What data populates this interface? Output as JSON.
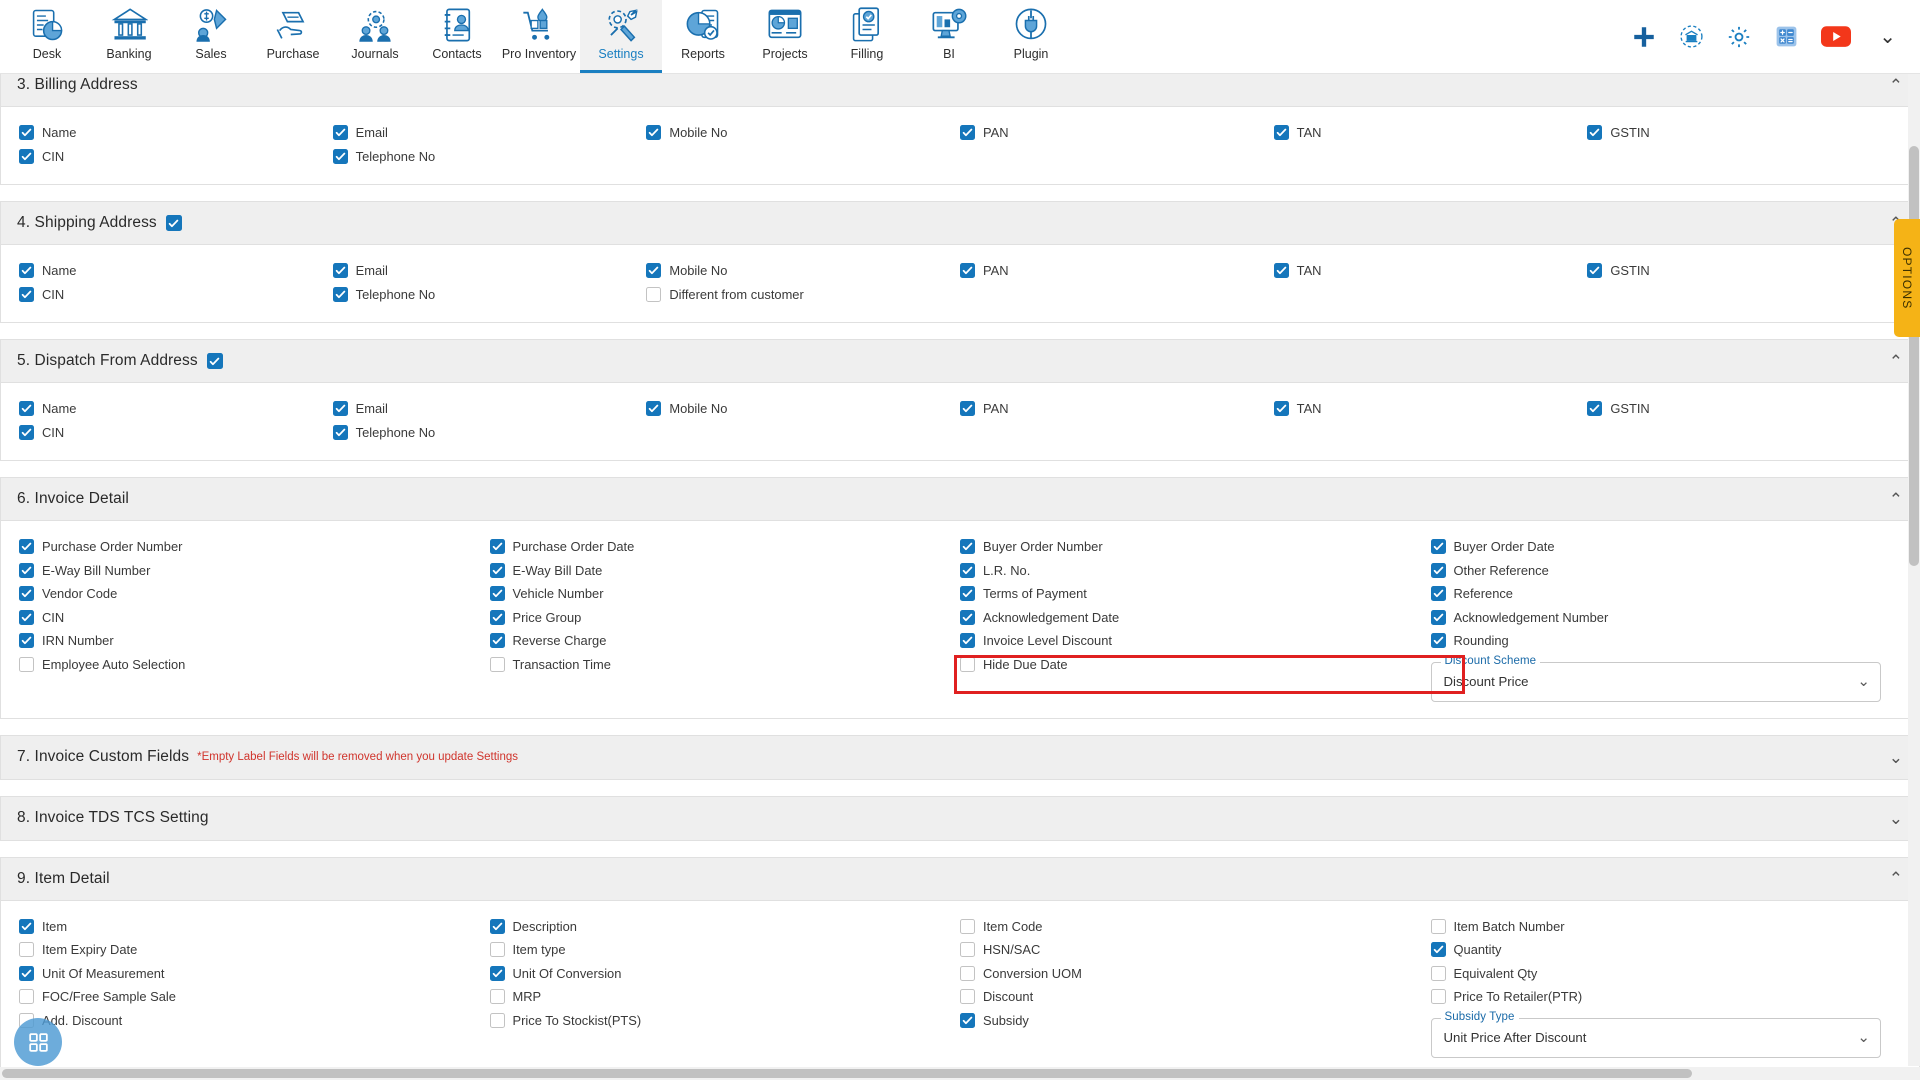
{
  "topnav": {
    "items": [
      {
        "label": "Desk",
        "icon": "desk-chart-icon",
        "active": false
      },
      {
        "label": "Banking",
        "icon": "bank-icon",
        "active": false
      },
      {
        "label": "Sales",
        "icon": "sales-tag-icon",
        "active": false
      },
      {
        "label": "Purchase",
        "icon": "purchase-bag-icon",
        "active": false
      },
      {
        "label": "Journals",
        "icon": "journals-gear-people-icon",
        "active": false
      },
      {
        "label": "Contacts",
        "icon": "contacts-book-icon",
        "active": false
      },
      {
        "label": "Pro Inventory",
        "icon": "inventory-cart-icon",
        "active": false
      },
      {
        "label": "Settings",
        "icon": "settings-tools-icon",
        "active": true
      },
      {
        "label": "Reports",
        "icon": "reports-pie-icon",
        "active": false
      },
      {
        "label": "Projects",
        "icon": "projects-board-icon",
        "active": false
      },
      {
        "label": "Filling",
        "icon": "filling-doc-check-icon",
        "active": false
      },
      {
        "label": "BI",
        "icon": "bi-monitor-icon",
        "active": false
      },
      {
        "label": "Plugin",
        "icon": "plugin-plug-icon",
        "active": false
      }
    ],
    "tools": [
      {
        "name": "add-plus-icon"
      },
      {
        "name": "bank-sync-icon"
      },
      {
        "name": "gear-icon"
      },
      {
        "name": "calculator-icon"
      },
      {
        "name": "youtube-icon"
      }
    ],
    "expand_caret": "⌄"
  },
  "options_tab": {
    "label": "OPTIONS"
  },
  "fab": {
    "name": "grid-apps-icon"
  },
  "caret_up": "⌃",
  "caret_down": "⌄",
  "sections": [
    {
      "title": "3. Billing Address",
      "has_head_check": false,
      "expanded": true,
      "columns": 6,
      "items": [
        {
          "label": "Name",
          "checked": true
        },
        {
          "label": "Email",
          "checked": true
        },
        {
          "label": "Mobile No",
          "checked": true
        },
        {
          "label": "PAN",
          "checked": true
        },
        {
          "label": "TAN",
          "checked": true
        },
        {
          "label": "GSTIN",
          "checked": true
        },
        {
          "label": "CIN",
          "checked": true
        },
        {
          "label": "Telephone No",
          "checked": true
        },
        {
          "label": "",
          "checked": null
        },
        {
          "label": "",
          "checked": null
        },
        {
          "label": "",
          "checked": null
        },
        {
          "label": "",
          "checked": null
        }
      ]
    },
    {
      "title": "4. Shipping Address",
      "has_head_check": true,
      "head_checked": true,
      "expanded": true,
      "columns": 6,
      "items": [
        {
          "label": "Name",
          "checked": true
        },
        {
          "label": "Email",
          "checked": true
        },
        {
          "label": "Mobile No",
          "checked": true
        },
        {
          "label": "PAN",
          "checked": true
        },
        {
          "label": "TAN",
          "checked": true
        },
        {
          "label": "GSTIN",
          "checked": true
        },
        {
          "label": "CIN",
          "checked": true
        },
        {
          "label": "Telephone No",
          "checked": true
        },
        {
          "label": "Different from customer",
          "checked": false
        },
        {
          "label": "",
          "checked": null
        },
        {
          "label": "",
          "checked": null
        },
        {
          "label": "",
          "checked": null
        }
      ]
    },
    {
      "title": "5. Dispatch From Address",
      "has_head_check": true,
      "head_checked": true,
      "expanded": true,
      "columns": 6,
      "items": [
        {
          "label": "Name",
          "checked": true
        },
        {
          "label": "Email",
          "checked": true
        },
        {
          "label": "Mobile No",
          "checked": true
        },
        {
          "label": "PAN",
          "checked": true
        },
        {
          "label": "TAN",
          "checked": true
        },
        {
          "label": "GSTIN",
          "checked": true
        },
        {
          "label": "CIN",
          "checked": true
        },
        {
          "label": "Telephone No",
          "checked": true
        },
        {
          "label": "",
          "checked": null
        },
        {
          "label": "",
          "checked": null
        },
        {
          "label": "",
          "checked": null
        },
        {
          "label": "",
          "checked": null
        }
      ]
    },
    {
      "title": "6. Invoice Detail",
      "has_head_check": false,
      "expanded": true,
      "columns": 4,
      "items": [
        {
          "label": "Purchase Order Number",
          "checked": true
        },
        {
          "label": "Purchase Order Date",
          "checked": true
        },
        {
          "label": "Buyer Order Number",
          "checked": true
        },
        {
          "label": "Buyer Order Date",
          "checked": true
        },
        {
          "label": "E-Way Bill Number",
          "checked": true
        },
        {
          "label": "E-Way Bill Date",
          "checked": true
        },
        {
          "label": "L.R. No.",
          "checked": true
        },
        {
          "label": "Other Reference",
          "checked": true
        },
        {
          "label": "Vendor Code",
          "checked": true
        },
        {
          "label": "Vehicle Number",
          "checked": true
        },
        {
          "label": "Terms of Payment",
          "checked": true
        },
        {
          "label": "Reference",
          "checked": true
        },
        {
          "label": "CIN",
          "checked": true
        },
        {
          "label": "Price Group",
          "checked": true
        },
        {
          "label": "Acknowledgement Date",
          "checked": true
        },
        {
          "label": "Acknowledgement Number",
          "checked": true
        },
        {
          "label": "IRN Number",
          "checked": true
        },
        {
          "label": "Reverse Charge",
          "checked": true
        },
        {
          "label": "Invoice Level Discount",
          "checked": true
        },
        {
          "label": "Rounding",
          "checked": true
        },
        {
          "label": "Employee Auto Selection",
          "checked": false
        },
        {
          "label": "Transaction Time",
          "checked": false
        },
        {
          "label": "Hide Due Date",
          "checked": false,
          "annotated": true
        },
        {
          "label": "",
          "checked": null,
          "select": {
            "legend": "Discount Scheme",
            "value": "Discount Price"
          }
        }
      ]
    },
    {
      "title": "7. Invoice Custom Fields",
      "note": "*Empty Label Fields will be removed when you update Settings",
      "has_head_check": false,
      "expanded": false,
      "columns": 4,
      "items": []
    },
    {
      "title": "8. Invoice TDS TCS Setting",
      "has_head_check": false,
      "expanded": false,
      "columns": 4,
      "items": []
    },
    {
      "title": "9. Item Detail",
      "has_head_check": false,
      "expanded": true,
      "columns": 4,
      "items": [
        {
          "label": "Item",
          "checked": true
        },
        {
          "label": "Description",
          "checked": true
        },
        {
          "label": "Item Code",
          "checked": false
        },
        {
          "label": "Item Batch Number",
          "checked": false
        },
        {
          "label": "Item Expiry Date",
          "checked": false
        },
        {
          "label": "Item type",
          "checked": false
        },
        {
          "label": "HSN/SAC",
          "checked": false
        },
        {
          "label": "Quantity",
          "checked": true
        },
        {
          "label": "Unit Of Measurement",
          "checked": true
        },
        {
          "label": "Unit Of Conversion",
          "checked": true
        },
        {
          "label": "Conversion UOM",
          "checked": false
        },
        {
          "label": "Equivalent Qty",
          "checked": false
        },
        {
          "label": "FOC/Free Sample Sale",
          "checked": false
        },
        {
          "label": "MRP",
          "checked": false
        },
        {
          "label": "Discount",
          "checked": false
        },
        {
          "label": "Price To Retailer(PTR)",
          "checked": false
        },
        {
          "label": "Add. Discount",
          "checked": false
        },
        {
          "label": "Price To Stockist(PTS)",
          "checked": false
        },
        {
          "label": "Subsidy",
          "checked": true
        },
        {
          "label": "",
          "checked": null,
          "select": {
            "legend": "Subsidy Type",
            "value": "Unit Price After Discount"
          }
        }
      ]
    }
  ]
}
